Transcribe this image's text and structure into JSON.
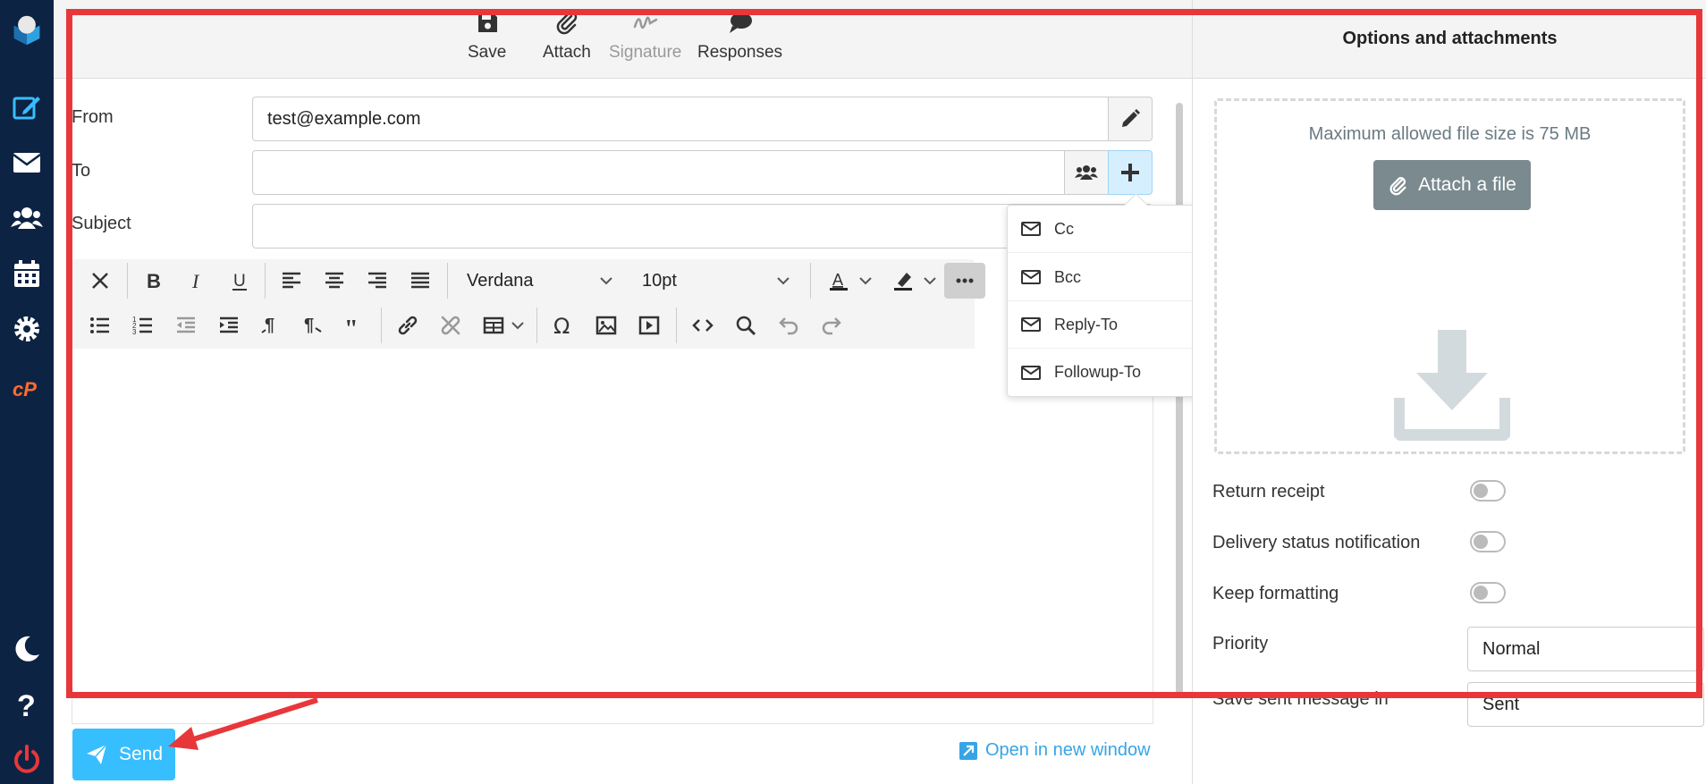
{
  "toolbar": {
    "save": "Save",
    "attach": "Attach",
    "signature": "Signature",
    "responses": "Responses"
  },
  "form": {
    "from_label": "From",
    "from_value": "test@example.com",
    "to_label": "To",
    "to_value": "",
    "subject_label": "Subject",
    "subject_value": ""
  },
  "editor": {
    "font_family": "Verdana",
    "font_size": "10pt"
  },
  "recipient_menu": {
    "items": [
      "Cc",
      "Bcc",
      "Reply-To",
      "Followup-To"
    ]
  },
  "right_pane": {
    "title": "Options and attachments",
    "max_size_text": "Maximum allowed file size is 75 MB",
    "attach_button": "Attach a file",
    "options": {
      "return_receipt": "Return receipt",
      "delivery_status": "Delivery status notification",
      "keep_formatting": "Keep formatting",
      "priority_label": "Priority",
      "priority_value": "Normal",
      "save_sent_label": "Save sent message in",
      "save_sent_value": "Sent"
    }
  },
  "bottom": {
    "send": "Send",
    "open_new_window": "Open in new window"
  },
  "colors": {
    "nav_bg": "#0d2344",
    "accent": "#37beff",
    "annotation": "#e8373a",
    "cpanel": "#ff6c2c",
    "logout": "#e8373a"
  }
}
